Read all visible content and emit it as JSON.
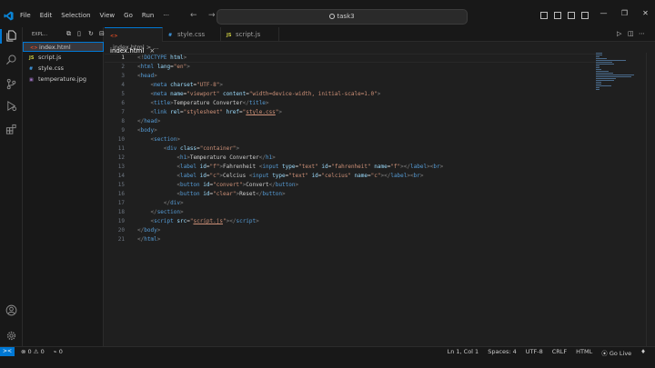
{
  "menu": [
    "File",
    "Edit",
    "Selection",
    "View",
    "Go",
    "Run",
    "···"
  ],
  "search": {
    "text": "task3"
  },
  "explorer": {
    "title": "EXPL...",
    "files": [
      {
        "name": "index.html",
        "type": "html",
        "active": true
      },
      {
        "name": "script.js",
        "type": "js",
        "active": false
      },
      {
        "name": "style.css",
        "type": "css",
        "active": false
      },
      {
        "name": "temperature.jpg",
        "type": "img",
        "active": false
      }
    ]
  },
  "tabs": [
    {
      "label": "index.html",
      "type": "html",
      "active": true
    },
    {
      "label": "style.css",
      "type": "css",
      "active": false
    },
    {
      "label": "script.js",
      "type": "js",
      "active": false
    }
  ],
  "breadcrumb": "index.html > ...",
  "code_lines": [
    [
      [
        "b",
        "<!"
      ],
      [
        "t",
        "DOCTYPE"
      ],
      [
        "a",
        " html"
      ],
      [
        "b",
        ">"
      ]
    ],
    [
      [
        "b",
        "<"
      ],
      [
        "t",
        "html"
      ],
      [
        "a",
        " lang"
      ],
      [
        "p",
        "="
      ],
      [
        "s",
        "\"en\""
      ],
      [
        "b",
        ">"
      ]
    ],
    [
      [
        "b",
        "<"
      ],
      [
        "t",
        "head"
      ],
      [
        "b",
        ">"
      ]
    ],
    [
      [
        "p",
        "    "
      ],
      [
        "b",
        "<"
      ],
      [
        "t",
        "meta"
      ],
      [
        "a",
        " charset"
      ],
      [
        "p",
        "="
      ],
      [
        "s",
        "\"UTF-8\""
      ],
      [
        "b",
        ">"
      ]
    ],
    [
      [
        "p",
        "    "
      ],
      [
        "b",
        "<"
      ],
      [
        "t",
        "meta"
      ],
      [
        "a",
        " name"
      ],
      [
        "p",
        "="
      ],
      [
        "s",
        "\"viewport\""
      ],
      [
        "a",
        " content"
      ],
      [
        "p",
        "="
      ],
      [
        "s",
        "\"width=device-width, initial-scale=1.0\""
      ],
      [
        "b",
        ">"
      ]
    ],
    [
      [
        "p",
        "    "
      ],
      [
        "b",
        "<"
      ],
      [
        "t",
        "title"
      ],
      [
        "b",
        ">"
      ],
      [
        "p",
        "Temperature Converter"
      ],
      [
        "b",
        "</"
      ],
      [
        "t",
        "title"
      ],
      [
        "b",
        ">"
      ]
    ],
    [
      [
        "p",
        "    "
      ],
      [
        "b",
        "<"
      ],
      [
        "t",
        "link"
      ],
      [
        "a",
        " rel"
      ],
      [
        "p",
        "="
      ],
      [
        "s",
        "\"stylesheet\""
      ],
      [
        "a",
        " href"
      ],
      [
        "p",
        "="
      ],
      [
        "s",
        "\""
      ],
      [
        "u",
        "style.css"
      ],
      [
        "s",
        "\""
      ],
      [
        "b",
        ">"
      ]
    ],
    [
      [
        "b",
        "</"
      ],
      [
        "t",
        "head"
      ],
      [
        "b",
        ">"
      ]
    ],
    [
      [
        "b",
        "<"
      ],
      [
        "t",
        "body"
      ],
      [
        "b",
        ">"
      ]
    ],
    [
      [
        "p",
        "    "
      ],
      [
        "b",
        "<"
      ],
      [
        "t",
        "section"
      ],
      [
        "b",
        ">"
      ]
    ],
    [
      [
        "p",
        "        "
      ],
      [
        "b",
        "<"
      ],
      [
        "t",
        "div"
      ],
      [
        "a",
        " class"
      ],
      [
        "p",
        "="
      ],
      [
        "s",
        "\"container\""
      ],
      [
        "b",
        ">"
      ]
    ],
    [
      [
        "p",
        "            "
      ],
      [
        "b",
        "<"
      ],
      [
        "t",
        "h1"
      ],
      [
        "b",
        ">"
      ],
      [
        "p",
        "Temperature Converter"
      ],
      [
        "b",
        "</"
      ],
      [
        "t",
        "h1"
      ],
      [
        "b",
        ">"
      ]
    ],
    [
      [
        "p",
        "            "
      ],
      [
        "b",
        "<"
      ],
      [
        "t",
        "label"
      ],
      [
        "a",
        " id"
      ],
      [
        "p",
        "="
      ],
      [
        "s",
        "\"f\""
      ],
      [
        "b",
        ">"
      ],
      [
        "p",
        "Fahrenheit "
      ],
      [
        "b",
        "<"
      ],
      [
        "t",
        "input"
      ],
      [
        "a",
        " type"
      ],
      [
        "p",
        "="
      ],
      [
        "s",
        "\"text\""
      ],
      [
        "a",
        " id"
      ],
      [
        "p",
        "="
      ],
      [
        "s",
        "\"fahrenheit\""
      ],
      [
        "a",
        " name"
      ],
      [
        "p",
        "="
      ],
      [
        "s",
        "\"f\""
      ],
      [
        "b",
        ">"
      ],
      [
        "b",
        "</"
      ],
      [
        "t",
        "label"
      ],
      [
        "b",
        ">"
      ],
      [
        "b",
        "<"
      ],
      [
        "t",
        "br"
      ],
      [
        "b",
        ">"
      ]
    ],
    [
      [
        "p",
        "            "
      ],
      [
        "b",
        "<"
      ],
      [
        "t",
        "label"
      ],
      [
        "a",
        " id"
      ],
      [
        "p",
        "="
      ],
      [
        "s",
        "\"c\""
      ],
      [
        "b",
        ">"
      ],
      [
        "p",
        "Celcius "
      ],
      [
        "b",
        "<"
      ],
      [
        "t",
        "input"
      ],
      [
        "a",
        " type"
      ],
      [
        "p",
        "="
      ],
      [
        "s",
        "\"text\""
      ],
      [
        "a",
        " id"
      ],
      [
        "p",
        "="
      ],
      [
        "s",
        "\"celcius\""
      ],
      [
        "a",
        " name"
      ],
      [
        "p",
        "="
      ],
      [
        "s",
        "\"c\""
      ],
      [
        "b",
        ">"
      ],
      [
        "b",
        "</"
      ],
      [
        "t",
        "label"
      ],
      [
        "b",
        ">"
      ],
      [
        "b",
        "<"
      ],
      [
        "t",
        "br"
      ],
      [
        "b",
        ">"
      ]
    ],
    [
      [
        "p",
        "            "
      ],
      [
        "b",
        "<"
      ],
      [
        "t",
        "button"
      ],
      [
        "a",
        " id"
      ],
      [
        "p",
        "="
      ],
      [
        "s",
        "\"convert\""
      ],
      [
        "b",
        ">"
      ],
      [
        "p",
        "Convert"
      ],
      [
        "b",
        "</"
      ],
      [
        "t",
        "button"
      ],
      [
        "b",
        ">"
      ]
    ],
    [
      [
        "p",
        "            "
      ],
      [
        "b",
        "<"
      ],
      [
        "t",
        "button"
      ],
      [
        "a",
        " id"
      ],
      [
        "p",
        "="
      ],
      [
        "s",
        "\"clear\""
      ],
      [
        "b",
        ">"
      ],
      [
        "p",
        "Reset"
      ],
      [
        "b",
        "</"
      ],
      [
        "t",
        "button"
      ],
      [
        "b",
        ">"
      ]
    ],
    [
      [
        "p",
        "        "
      ],
      [
        "b",
        "</"
      ],
      [
        "t",
        "div"
      ],
      [
        "b",
        ">"
      ]
    ],
    [
      [
        "p",
        "    "
      ],
      [
        "b",
        "</"
      ],
      [
        "t",
        "section"
      ],
      [
        "b",
        ">"
      ]
    ],
    [
      [
        "p",
        "    "
      ],
      [
        "b",
        "<"
      ],
      [
        "t",
        "script"
      ],
      [
        "a",
        " src"
      ],
      [
        "p",
        "="
      ],
      [
        "s",
        "\""
      ],
      [
        "u",
        "script.js"
      ],
      [
        "s",
        "\""
      ],
      [
        "b",
        ">"
      ],
      [
        "b",
        "</"
      ],
      [
        "t",
        "script"
      ],
      [
        "b",
        ">"
      ]
    ],
    [
      [
        "b",
        "</"
      ],
      [
        "t",
        "body"
      ],
      [
        "b",
        ">"
      ]
    ],
    [
      [
        "b",
        "</"
      ],
      [
        "t",
        "html"
      ],
      [
        "b",
        ">"
      ]
    ]
  ],
  "status": {
    "remote": "><",
    "problems": "⊗ 0 ⚠ 0",
    "ports": "⌁ 0",
    "position": "Ln 1, Col 1",
    "spaces": "Spaces: 4",
    "encoding": "UTF-8",
    "eol": "CRLF",
    "language": "HTML",
    "golive": "⦿ Go Live"
  },
  "colors": {
    "accent": "#0078d4",
    "tag": "#569cd6",
    "attr": "#9cdcfe",
    "string": "#ce9178"
  }
}
